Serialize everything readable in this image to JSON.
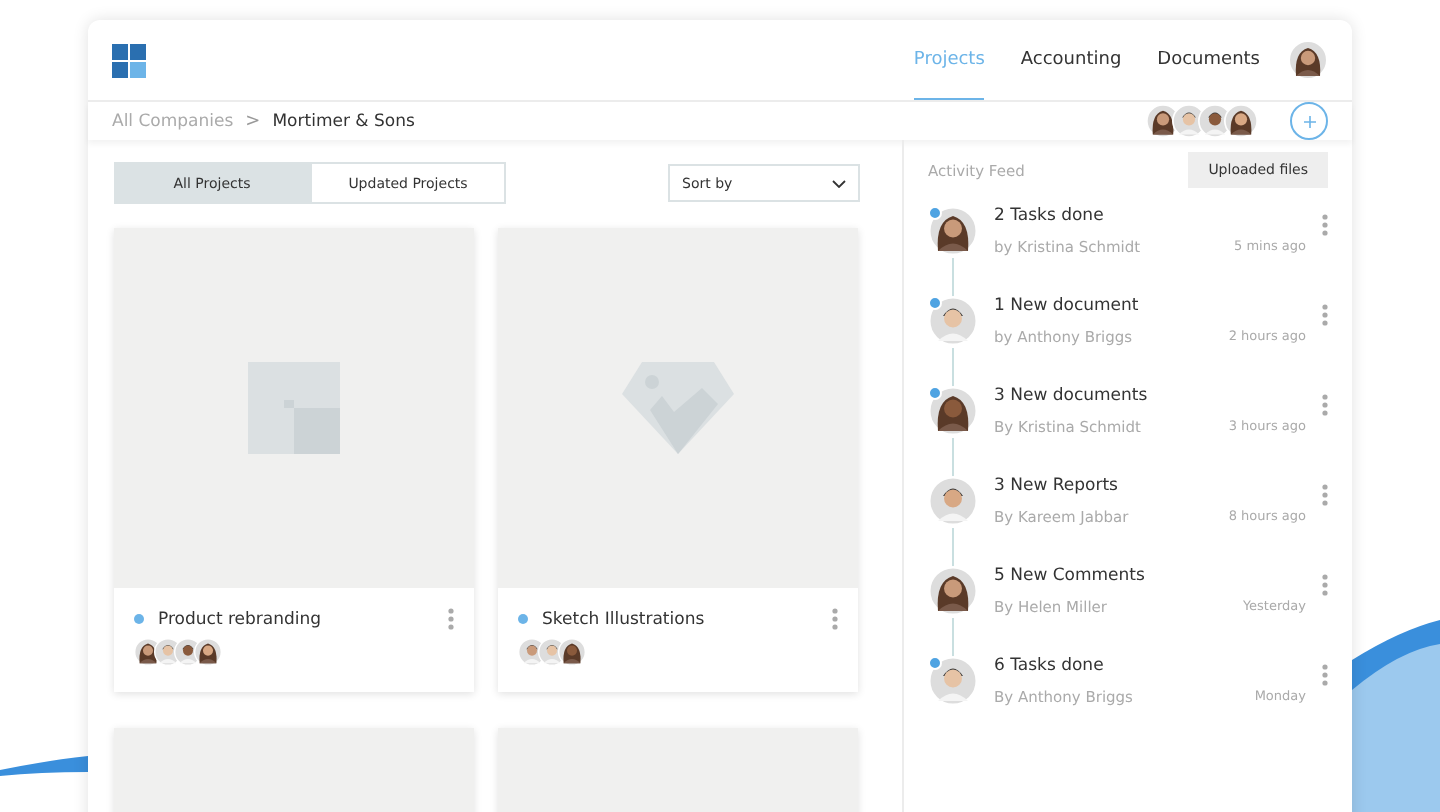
{
  "nav": {
    "tabs": [
      {
        "label": "Projects",
        "selected": true
      },
      {
        "label": "Accounting",
        "selected": false
      },
      {
        "label": "Documents",
        "selected": false
      }
    ],
    "user": {
      "kind": "woman"
    }
  },
  "breadcrumb": {
    "items": [
      "All Companies",
      "Mortimer & Sons"
    ],
    "separator": ">",
    "members": [
      {
        "kind": "woman"
      },
      {
        "kind": "man"
      },
      {
        "kind": "man"
      },
      {
        "kind": "woman"
      }
    ]
  },
  "filters": {
    "tabs": [
      {
        "label": "All Projects",
        "selected": true
      },
      {
        "label": "Updated Projects",
        "selected": false
      }
    ],
    "sort": {
      "label": "Sort by"
    }
  },
  "projects": [
    {
      "title": "Product rebranding",
      "color": "#6cb4e8",
      "kind": "square",
      "members": [
        {
          "kind": "woman"
        },
        {
          "kind": "man"
        },
        {
          "kind": "man"
        },
        {
          "kind": "woman"
        }
      ]
    },
    {
      "title": "Sketch Illustrations",
      "color": "#6cb4e8",
      "kind": "diamond",
      "members": [
        {
          "kind": "man"
        },
        {
          "kind": "man"
        },
        {
          "kind": "woman"
        }
      ]
    },
    {
      "kind": "blank"
    },
    {
      "kind": "blank"
    }
  ],
  "feed": {
    "title": "Activity Feed",
    "button": "Uploaded files",
    "items": [
      {
        "title": "2 Tasks done",
        "by": "by Kristina Schmidt",
        "time": "5 mins ago",
        "unread": true,
        "avatar": {
          "kind": "woman"
        }
      },
      {
        "title": "1 New document",
        "by": "by Anthony Briggs",
        "time": "2 hours ago",
        "unread": true,
        "avatar": {
          "kind": "man"
        }
      },
      {
        "title": "3 New documents",
        "by": "By Kristina Schmidt",
        "time": "3 hours ago",
        "unread": true,
        "avatar": {
          "kind": "woman"
        }
      },
      {
        "title": "3 New Reports",
        "by": "By Kareem Jabbar",
        "time": "8 hours ago",
        "unread": false,
        "avatar": {
          "kind": "man"
        }
      },
      {
        "title": "5 New Comments",
        "by": "By Helen Miller",
        "time": "Yesterday",
        "unread": false,
        "avatar": {
          "kind": "woman"
        }
      },
      {
        "title": "6 Tasks done",
        "by": "By Anthony Briggs",
        "time": "Monday",
        "unread": true,
        "avatar": {
          "kind": "man"
        }
      }
    ]
  }
}
